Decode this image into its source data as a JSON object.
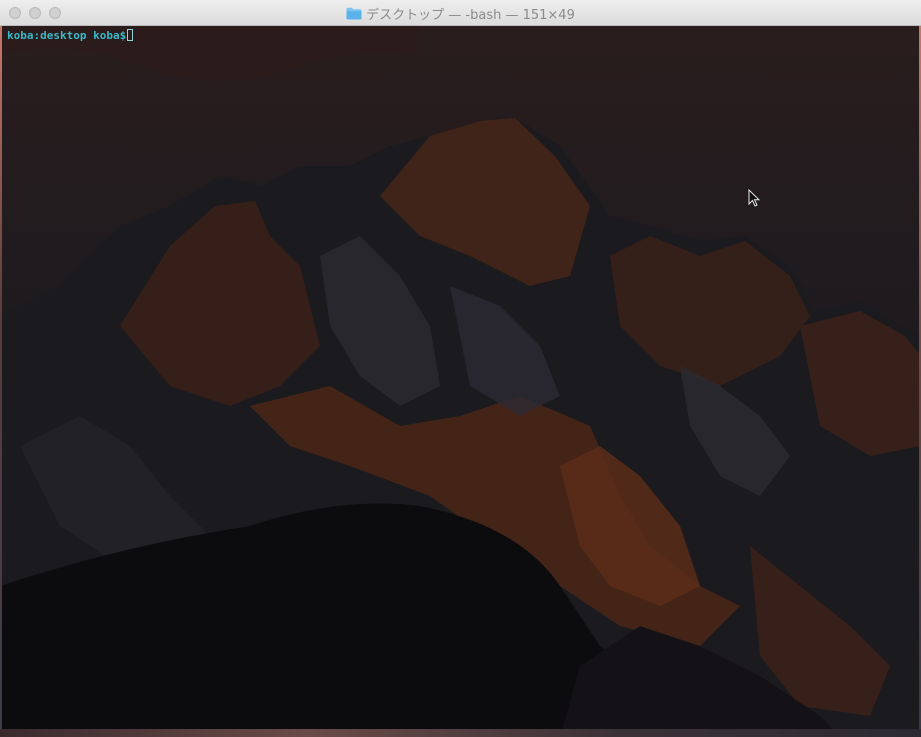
{
  "window": {
    "title": "デスクトップ — -bash — 151×49",
    "icon": "folder-icon"
  },
  "terminal": {
    "prompt": "koba:desktop koba$",
    "input": ""
  },
  "colors": {
    "prompt": "#39b8c8",
    "titlebar": "#e4e4e4",
    "title_text": "#8a8a8a"
  }
}
